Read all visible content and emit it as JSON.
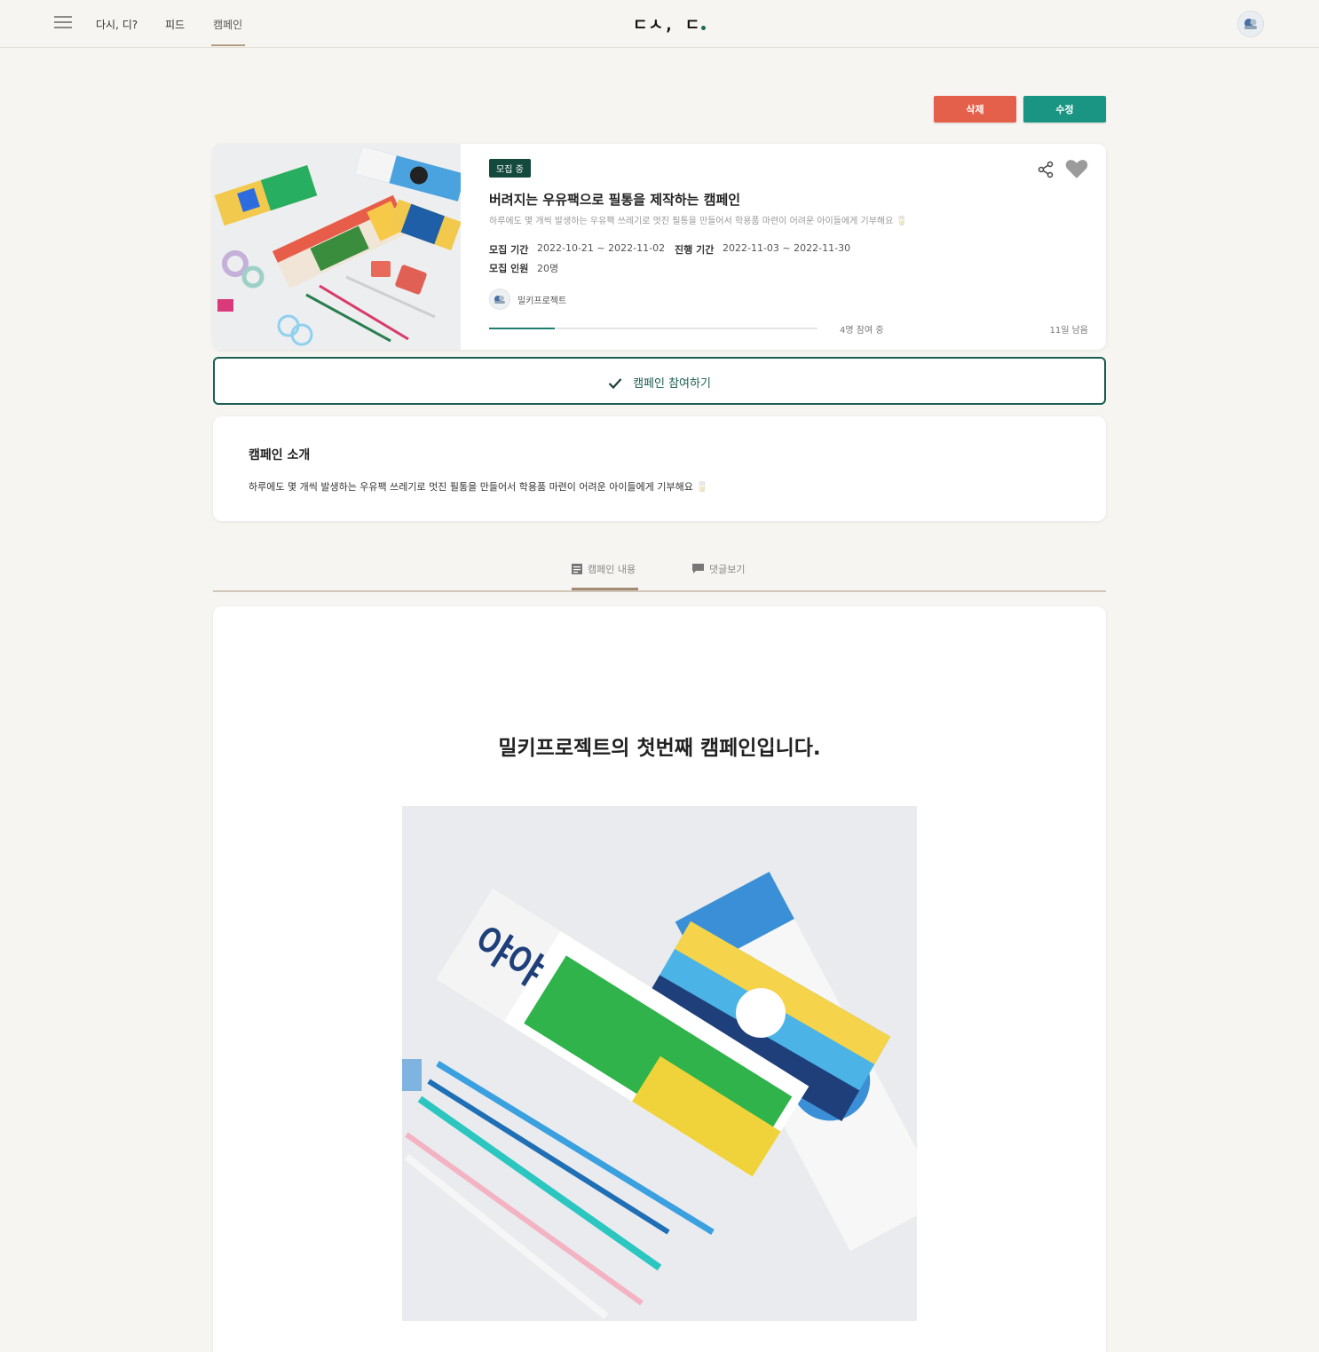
{
  "header": {
    "logo": "ㄷㅅ, ㄷ",
    "nav": [
      "다시, 디?",
      "피드",
      "캠페인"
    ],
    "active_nav": "캠페인"
  },
  "actions": {
    "delete_label": "삭제",
    "edit_label": "수정",
    "delete_color": "#e5604a",
    "edit_color": "#1a9483"
  },
  "campaign": {
    "badge": "모집 중",
    "title": "버려지는 우유팩으로 필통을 제작하는 캠페인",
    "description": "하루에도 몇 개씩 발생하는 우유팩 쓰레기로 멋진 필통을 만들어서 학용품 마련이 어려운 아이들에게 기부해요 🥛",
    "recruit_period_label": "모집 기간",
    "recruit_period": "2022-10-21 ~ 2022-11-02",
    "progress_period_label": "진행 기간",
    "progress_period": "2022-11-03 ~ 2022-11-30",
    "headcount_label": "모집 인원",
    "headcount": "20명",
    "organizer": "밀키프로젝트",
    "participants": "4명 참여 중",
    "days_left": "11일 남음",
    "progress_fraction": 0.2
  },
  "join": {
    "label": "캠페인 참여하기"
  },
  "intro": {
    "title": "캠페인 소개",
    "text": "하루에도 몇 개씩 발생하는 우유팩 쓰레기로 멋진 필통을 만들어서 학용품 마련이 어려운 아이들에게 기부해요 🥛"
  },
  "tabs": {
    "content": "캠페인 내용",
    "comments": "댓글보기"
  },
  "content": {
    "heading": "밀키프로젝트의 첫번째 캠페인입니다."
  },
  "icons": {
    "menu": "hamburger-icon",
    "share": "share-icon",
    "like": "heart-icon",
    "check": "check-icon",
    "content_tab": "document-icon",
    "comment_tab": "comment-icon"
  }
}
